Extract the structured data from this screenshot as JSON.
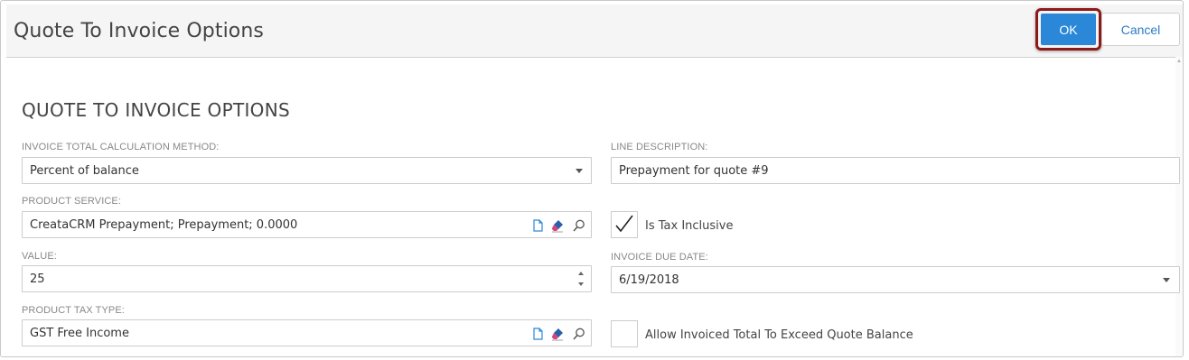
{
  "header": {
    "title": "Quote To Invoice Options",
    "ok_label": "OK",
    "cancel_label": "Cancel"
  },
  "section": {
    "title": "QUOTE TO INVOICE OPTIONS"
  },
  "left": {
    "calc_method": {
      "label": "INVOICE TOTAL CALCULATION METHOD:",
      "value": "Percent of balance"
    },
    "product_service": {
      "label": "PRODUCT SERVICE:",
      "value": "CreataCRM Prepayment; Prepayment; 0.0000"
    },
    "value": {
      "label": "VALUE:",
      "value": "25"
    },
    "product_tax_type": {
      "label": "PRODUCT TAX TYPE:",
      "value": "GST Free Income"
    }
  },
  "right": {
    "line_description": {
      "label": "LINE DESCRIPTION:",
      "value": "Prepayment for quote #9"
    },
    "is_tax_inclusive": {
      "label": "Is Tax Inclusive",
      "checked": true
    },
    "invoice_due_date": {
      "label": "INVOICE DUE DATE:",
      "value": "6/19/2018"
    },
    "allow_exceed": {
      "label": "Allow Invoiced Total To Exceed Quote Balance",
      "checked": false
    }
  },
  "icons": [
    "copy-icon",
    "eraser-icon",
    "search-icon",
    "checkmark-icon",
    "chevron-down-icon",
    "spinner-up-icon",
    "spinner-down-icon"
  ],
  "colors": {
    "ok_button": "#2b88d8",
    "ok_highlight": "#8b1a1a",
    "cancel_text": "#2b7cc4",
    "eraser_pink": "#e0407a",
    "copy_blue": "#2b88d8"
  }
}
